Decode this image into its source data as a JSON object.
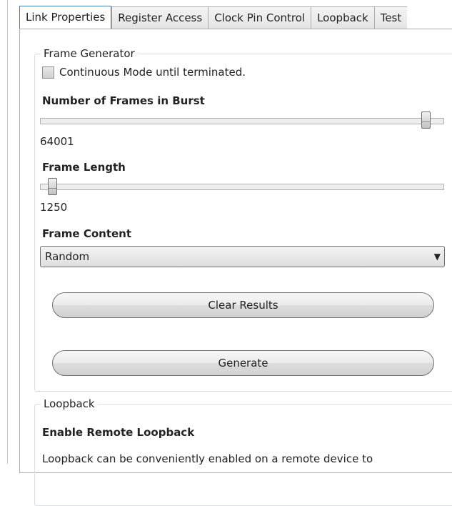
{
  "tabs": [
    "Link Properties",
    "Register Access",
    "Clock Pin Control",
    "Loopback",
    "Test"
  ],
  "active_tab": 0,
  "frame_generator": {
    "title": "Frame Generator",
    "continuous_mode_label": "Continuous Mode until terminated.",
    "continuous_mode_checked": false,
    "frames_in_burst_label": "Number of Frames in Burst",
    "frames_in_burst_value": "64001",
    "frames_in_burst_fraction": 0.97,
    "frame_length_label": "Frame Length",
    "frame_length_value": "1250",
    "frame_length_fraction": 0.02,
    "frame_content_label": "Frame Content",
    "frame_content_value": "Random",
    "clear_results_label": "Clear Results",
    "generate_label": "Generate"
  },
  "loopback": {
    "title": "Loopback",
    "enable_remote_label": "Enable Remote Loopback",
    "description": "Loopback can be conveniently enabled on a remote device to"
  },
  "colors": {
    "active_tab_border": "#3c7fb1",
    "group_border": "#d5dfe5"
  }
}
